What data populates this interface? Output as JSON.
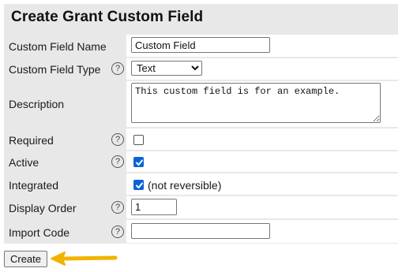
{
  "form": {
    "title": "Create Grant Custom Field",
    "fields": {
      "name": {
        "label": "Custom Field Name",
        "value": "Custom Field"
      },
      "type": {
        "label": "Custom Field Type",
        "selected": "Text",
        "options": [
          "Text"
        ]
      },
      "description": {
        "label": "Description",
        "value": "This custom field is for an example."
      },
      "required": {
        "label": "Required",
        "checked": false
      },
      "active": {
        "label": "Active",
        "checked": true
      },
      "integrated": {
        "label": "Integrated",
        "checked": true,
        "note": "(not reversible)"
      },
      "display_order": {
        "label": "Display Order",
        "value": "1"
      },
      "import_code": {
        "label": "Import Code",
        "value": ""
      }
    },
    "help_glyph": "?",
    "create_label": "Create"
  },
  "colors": {
    "panel_bg": "#e8e8e8",
    "checkbox_accent": "#0a64d8",
    "arrow_color": "#f0b400"
  },
  "icons": {
    "help": "question-circle-icon",
    "pointer": "arrow-left-icon"
  }
}
